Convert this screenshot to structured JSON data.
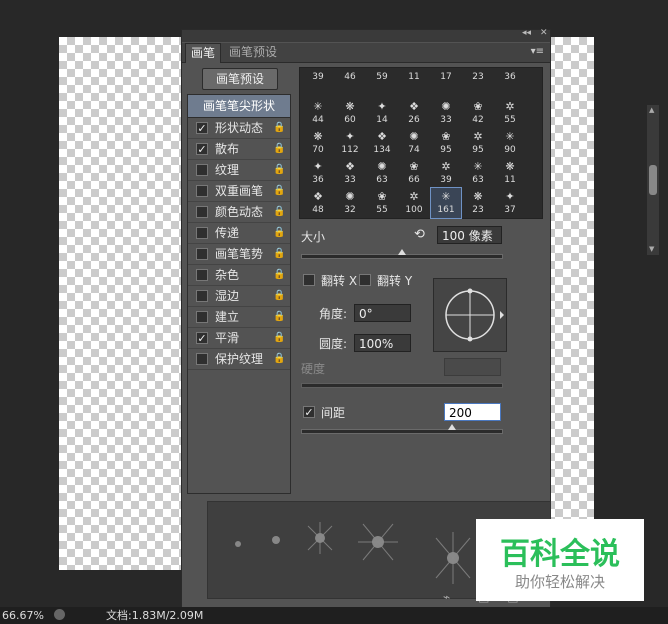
{
  "panel": {
    "tabs": [
      "画笔",
      "画笔预设"
    ],
    "title_controls": [
      "◂◂",
      "✕"
    ],
    "menu_glyph": "▾≡",
    "preset_button": "画笔预设",
    "list_header": "画笔笔尖形状",
    "options": [
      {
        "label": "形状动态",
        "checked": true,
        "lock": true
      },
      {
        "label": "散布",
        "checked": true,
        "lock": true
      },
      {
        "label": "纹理",
        "checked": false,
        "lock": true
      },
      {
        "label": "双重画笔",
        "checked": false,
        "lock": true
      },
      {
        "label": "颜色动态",
        "checked": false,
        "lock": true
      },
      {
        "label": "传递",
        "checked": false,
        "lock": true
      },
      {
        "label": "画笔笔势",
        "checked": false,
        "lock": true
      },
      {
        "label": "杂色",
        "checked": false,
        "lock": true
      },
      {
        "label": "湿边",
        "checked": false,
        "lock": true
      },
      {
        "label": "建立",
        "checked": false,
        "lock": true
      },
      {
        "label": "平滑",
        "checked": true,
        "lock": true
      },
      {
        "label": "保护纹理",
        "checked": false,
        "lock": true
      }
    ],
    "brush_rows": [
      [
        "39",
        "46",
        "59",
        "11",
        "17",
        "23",
        "36"
      ],
      [
        "44",
        "60",
        "14",
        "26",
        "33",
        "42",
        "55"
      ],
      [
        "70",
        "112",
        "134",
        "74",
        "95",
        "95",
        "90"
      ],
      [
        "36",
        "33",
        "63",
        "66",
        "39",
        "63",
        "11"
      ],
      [
        "48",
        "32",
        "55",
        "100",
        "161",
        "23",
        "37"
      ]
    ],
    "selected_brush": "161",
    "size_label": "大小",
    "size_value": "100 像素",
    "flip_x": "翻转 X",
    "flip_y": "翻转 Y",
    "angle_label": "角度:",
    "angle_value": "0°",
    "roundness_label": "圆度:",
    "roundness_value": "100%",
    "hardness_label": "硬度",
    "spacing_label": "间距",
    "spacing_value": "200",
    "spacing_checked": true
  },
  "status": {
    "zoom": "66.67%",
    "doc": "文档:1.83M/2.09M"
  },
  "watermark": {
    "big": "百科全说",
    "small": "助你轻松解决"
  }
}
